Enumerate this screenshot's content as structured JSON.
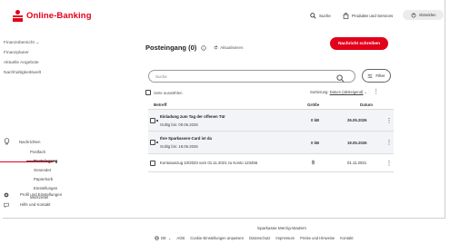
{
  "brand": {
    "name": "Online-Banking",
    "color": "#e2001a"
  },
  "header": {
    "search_label": "Suche",
    "products_label": "Produkte und Services",
    "logout_label": "Abmelden"
  },
  "sidebar": {
    "top_items": [
      {
        "label": "Finanzübersicht"
      },
      {
        "label": "Finanzplaner"
      },
      {
        "label": "Aktuelle Angebote"
      },
      {
        "label": "Nachhaltigkeitswelt"
      }
    ],
    "mail": {
      "label": "Nachrichten",
      "items": [
        {
          "label": "Postfach"
        },
        {
          "label": "Posteingang",
          "active": true
        },
        {
          "label": "Gesendet"
        },
        {
          "label": "Papierkorb"
        },
        {
          "label": "Einstellungen"
        }
      ],
      "merkzettel": "Merkzettel"
    },
    "footer_items": [
      {
        "label": "Profil und Einstellungen",
        "icon": "gear-icon"
      },
      {
        "label": "Hilfe und Kontakt",
        "icon": "chat-icon"
      }
    ]
  },
  "main": {
    "title": "Posteingang (0)",
    "refresh_label": "Aktualisieren",
    "compose_label": "Nachricht schreiben",
    "search_placeholder": "Suche",
    "filter_label": "Filter",
    "select_all_label": "Seite auswählen",
    "sort_label": "Sortierung:",
    "sort_value": "Datum (absteigend)",
    "columns": {
      "subject": "Betreff",
      "size": "Größe",
      "date": "Datum"
    },
    "rows": [
      {
        "subject": "Einladung zum Tag der offenen Tür",
        "validity": "Gültig bis: 09.06.2026",
        "size": "0 kB",
        "date": "26.05.2026",
        "unread": true
      },
      {
        "subject": "Ihre Sparkassen-Card ist da",
        "validity": "Gültig bis: 18.06.2026",
        "size": "0 kB",
        "date": "19.05.2026",
        "unread": true
      },
      {
        "subject": "Kontoauszug 10/2023 vom 01.11.2021 zu Konto 123456",
        "validity": "",
        "size": "",
        "date": "01.11.2021",
        "unread": false,
        "attachment": true
      }
    ]
  },
  "footer": {
    "bank_name": "Sparkasse Merzig-Wadern",
    "language": "DE",
    "links": [
      "AGB",
      "Cookie-Einstellungen anpassen",
      "Datenschutz",
      "Impressum",
      "Preise und Hinweise",
      "Kontakt"
    ]
  }
}
